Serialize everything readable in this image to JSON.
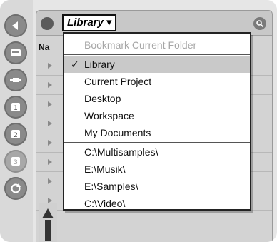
{
  "browser": {
    "location_button": "Library ▾",
    "column_header": "Na"
  },
  "menu": {
    "header": "Bookmark Current Folder",
    "places": [
      {
        "label": "Library",
        "checked": true
      },
      {
        "label": "Current Project",
        "checked": false
      },
      {
        "label": "Desktop",
        "checked": false
      },
      {
        "label": "Workspace",
        "checked": false
      },
      {
        "label": "My Documents",
        "checked": false
      }
    ],
    "bookmarks": [
      {
        "label": "C:\\Multisamples\\"
      },
      {
        "label": "E:\\Musik\\"
      },
      {
        "label": "E:\\Samples\\"
      },
      {
        "label": "C:\\Video\\"
      }
    ],
    "checkmark": "✓"
  },
  "icons": {
    "rail": [
      "back-icon",
      "disk-icon",
      "plugin-icon",
      "place-1-icon",
      "place-2-icon",
      "place-3-icon",
      "refresh-icon"
    ],
    "search": "search-icon",
    "headphones": "headphones-icon"
  }
}
